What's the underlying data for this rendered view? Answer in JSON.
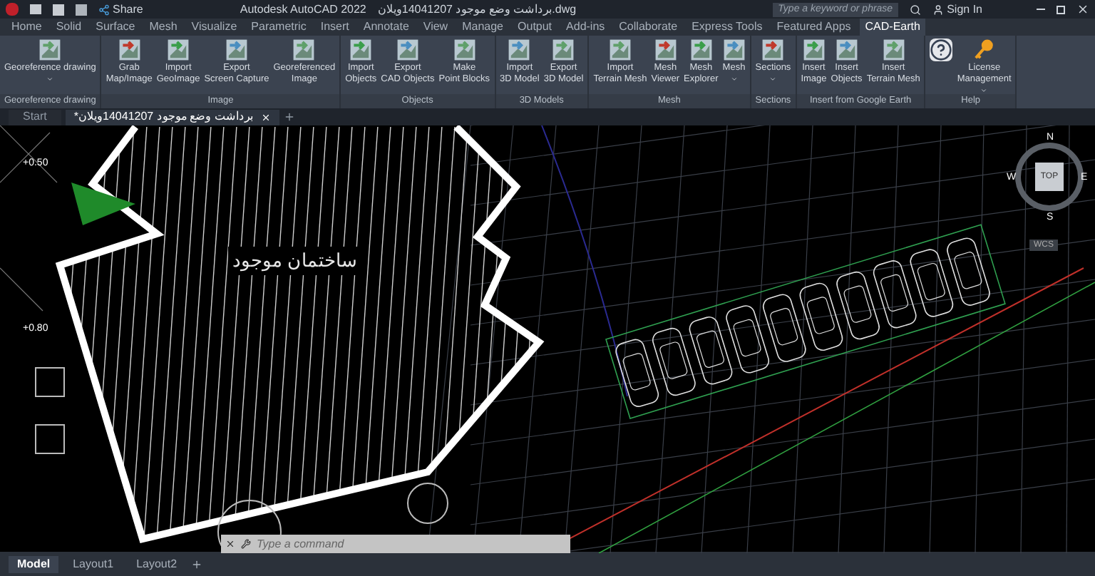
{
  "title_bar": {
    "share": "Share",
    "title": "Autodesk AutoCAD 2022",
    "file_name": "برداشت وضع موجود 14041207ویلان.dwg",
    "search": {
      "placeholder": "Type a keyword or phrase"
    },
    "sign_in": "Sign In"
  },
  "ribbon_tabs": [
    {
      "label": "Home",
      "selected": false
    },
    {
      "label": "Solid",
      "selected": false
    },
    {
      "label": "Surface",
      "selected": false
    },
    {
      "label": "Mesh",
      "selected": false
    },
    {
      "label": "Visualize",
      "selected": false
    },
    {
      "label": "Parametric",
      "selected": false
    },
    {
      "label": "Insert",
      "selected": false
    },
    {
      "label": "Annotate",
      "selected": false
    },
    {
      "label": "View",
      "selected": false
    },
    {
      "label": "Manage",
      "selected": false
    },
    {
      "label": "Output",
      "selected": false
    },
    {
      "label": "Add-ins",
      "selected": false
    },
    {
      "label": "Collaborate",
      "selected": false
    },
    {
      "label": "Express Tools",
      "selected": false
    },
    {
      "label": "Featured Apps",
      "selected": false
    },
    {
      "label": "CAD-Earth",
      "selected": true
    }
  ],
  "ribbon_groups": [
    {
      "title": "Georeference drawing",
      "buttons": [
        {
          "label": "Georeference drawing",
          "dropdown": true
        }
      ]
    },
    {
      "title": "Image",
      "buttons": [
        {
          "label": "Grab\nMap/Image",
          "dropdown": false
        },
        {
          "label": "Import\nGeoImage",
          "dropdown": false
        },
        {
          "label": "Export\nScreen Capture",
          "dropdown": false
        },
        {
          "label": "Georeferenced\nImage",
          "dropdown": false
        }
      ]
    },
    {
      "title": "Objects",
      "buttons": [
        {
          "label": "Import\nObjects",
          "dropdown": false
        },
        {
          "label": "Export\nCAD Objects",
          "dropdown": false
        },
        {
          "label": "Make\nPoint Blocks",
          "dropdown": false
        }
      ]
    },
    {
      "title": "3D Models",
      "buttons": [
        {
          "label": "Import\n3D Model",
          "dropdown": false
        },
        {
          "label": "Export\n3D Model",
          "dropdown": false
        }
      ]
    },
    {
      "title": "Mesh",
      "buttons": [
        {
          "label": "Import\nTerrain Mesh",
          "dropdown": false
        },
        {
          "label": "Mesh\nViewer",
          "dropdown": false
        },
        {
          "label": "Mesh\nExplorer",
          "dropdown": false
        },
        {
          "label": "Mesh",
          "dropdown": true
        }
      ]
    },
    {
      "title": "Sections",
      "buttons": [
        {
          "label": "Sections",
          "dropdown": true
        }
      ]
    },
    {
      "title": "Insert from Google Earth",
      "buttons": [
        {
          "label": "Insert\nImage",
          "dropdown": false
        },
        {
          "label": "Insert\nObjects",
          "dropdown": false
        },
        {
          "label": "Insert\nTerrain Mesh",
          "dropdown": false
        }
      ]
    },
    {
      "title": "Help",
      "buttons": [
        {
          "kind": "help",
          "dropdown": false
        },
        {
          "label": "License\nManagement",
          "kind": "key",
          "dropdown": true
        }
      ]
    }
  ],
  "document_tabs": [
    {
      "label": "Start",
      "selected": false,
      "closable": false
    },
    {
      "label": "*برداشت وضع موجود 14041207ویلان",
      "selected": true,
      "closable": true
    }
  ],
  "canvas": {
    "building_label": "ساختمان موجود",
    "level_marks": [
      "+0.50",
      "+0.80"
    ],
    "viewcube": {
      "top": "TOP",
      "north": "N",
      "east": "E",
      "south": "S",
      "west": "W",
      "ucs": "WCS"
    }
  },
  "command_line": {
    "placeholder": "Type a command"
  },
  "layout_tabs": [
    {
      "label": "Model",
      "selected": true
    },
    {
      "label": "Layout1",
      "selected": false
    },
    {
      "label": "Layout2",
      "selected": false
    }
  ]
}
